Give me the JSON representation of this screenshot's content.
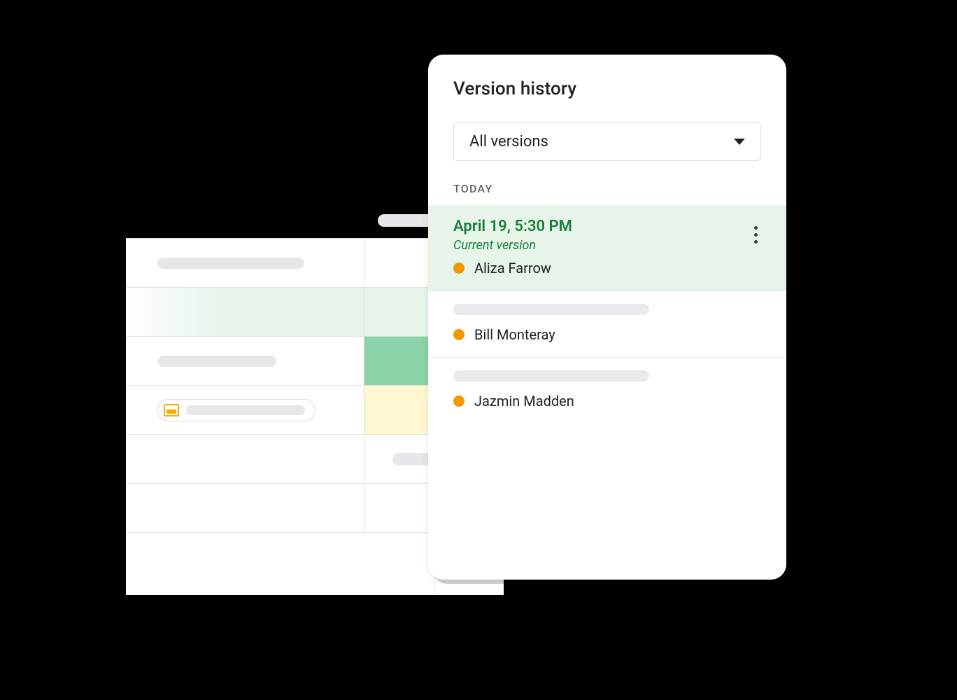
{
  "panel": {
    "title": "Version history",
    "dropdown_label": "All versions",
    "section_label": "TODAY",
    "versions": [
      {
        "date": "April 19, 5:30 PM",
        "subtitle": "Current version",
        "editor": "Aliza Farrow"
      },
      {
        "editor": "Bill Monteray"
      },
      {
        "editor": "Jazmin Madden"
      }
    ]
  }
}
